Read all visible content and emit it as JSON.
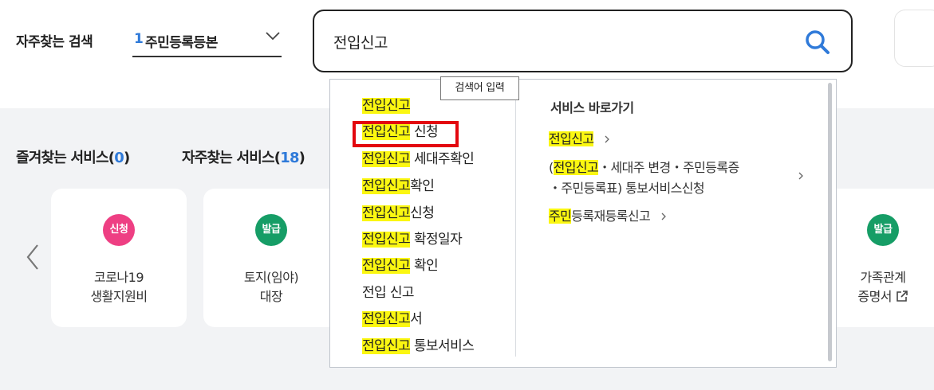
{
  "header": {
    "frequent_search_label": "자주찾는 검색",
    "selected_number": "1",
    "selected_value": "주민등록등본",
    "search_value": "전입신고",
    "search_tooltip": "검색어 입력"
  },
  "sections": {
    "fav_label": "즐겨찾는 서비스(",
    "fav_count": "0",
    "fav_close": ")",
    "freq_label": "자주찾는 서비스(",
    "freq_count": "18",
    "freq_close": ")"
  },
  "cards": [
    {
      "badge": "신청",
      "badge_color": "#ee3f83",
      "line1": "코로나19",
      "line2": "생활지원비"
    },
    {
      "badge": "발급",
      "badge_color": "#169d66",
      "line1": "토지(임야)",
      "line2": "대장"
    },
    {
      "badge": "발급",
      "badge_color": "#169d66",
      "line1": "가족관계",
      "line2": "증명서",
      "icon": "external-link-icon"
    }
  ],
  "suggestions": [
    {
      "hl": "전입신고",
      "rest": ""
    },
    {
      "hl": "전입신고",
      "rest": " 신청"
    },
    {
      "hl": "전입신고",
      "rest": " 세대주확인"
    },
    {
      "hl": "전입신고",
      "rest": "확인"
    },
    {
      "hl": "전입신고",
      "rest": "신청"
    },
    {
      "hl": "전입신고",
      "rest": " 확정일자"
    },
    {
      "hl": "전입신고",
      "rest": " 확인"
    },
    {
      "hl": "",
      "rest": "전입 신고"
    },
    {
      "hl": "전입신고",
      "rest": "서"
    },
    {
      "hl": "전입신고",
      "rest": " 통보서비스"
    }
  ],
  "service_shortcuts": {
    "title": "서비스 바로가기",
    "link1": {
      "hl": "전입신고",
      "rest": ""
    },
    "link2": {
      "pre": "(",
      "hl": "전입신고",
      "rest_line1": "・세대주 변경・주민등록증",
      "rest_line2": "・주민등록표) 통보서비스신청"
    },
    "link3": {
      "hl": "주민",
      "rest": "등록재등록신고"
    }
  },
  "colors": {
    "accent": "#2f7ad9",
    "highlight": "#fbf711",
    "selection_border": "#e3070f"
  }
}
